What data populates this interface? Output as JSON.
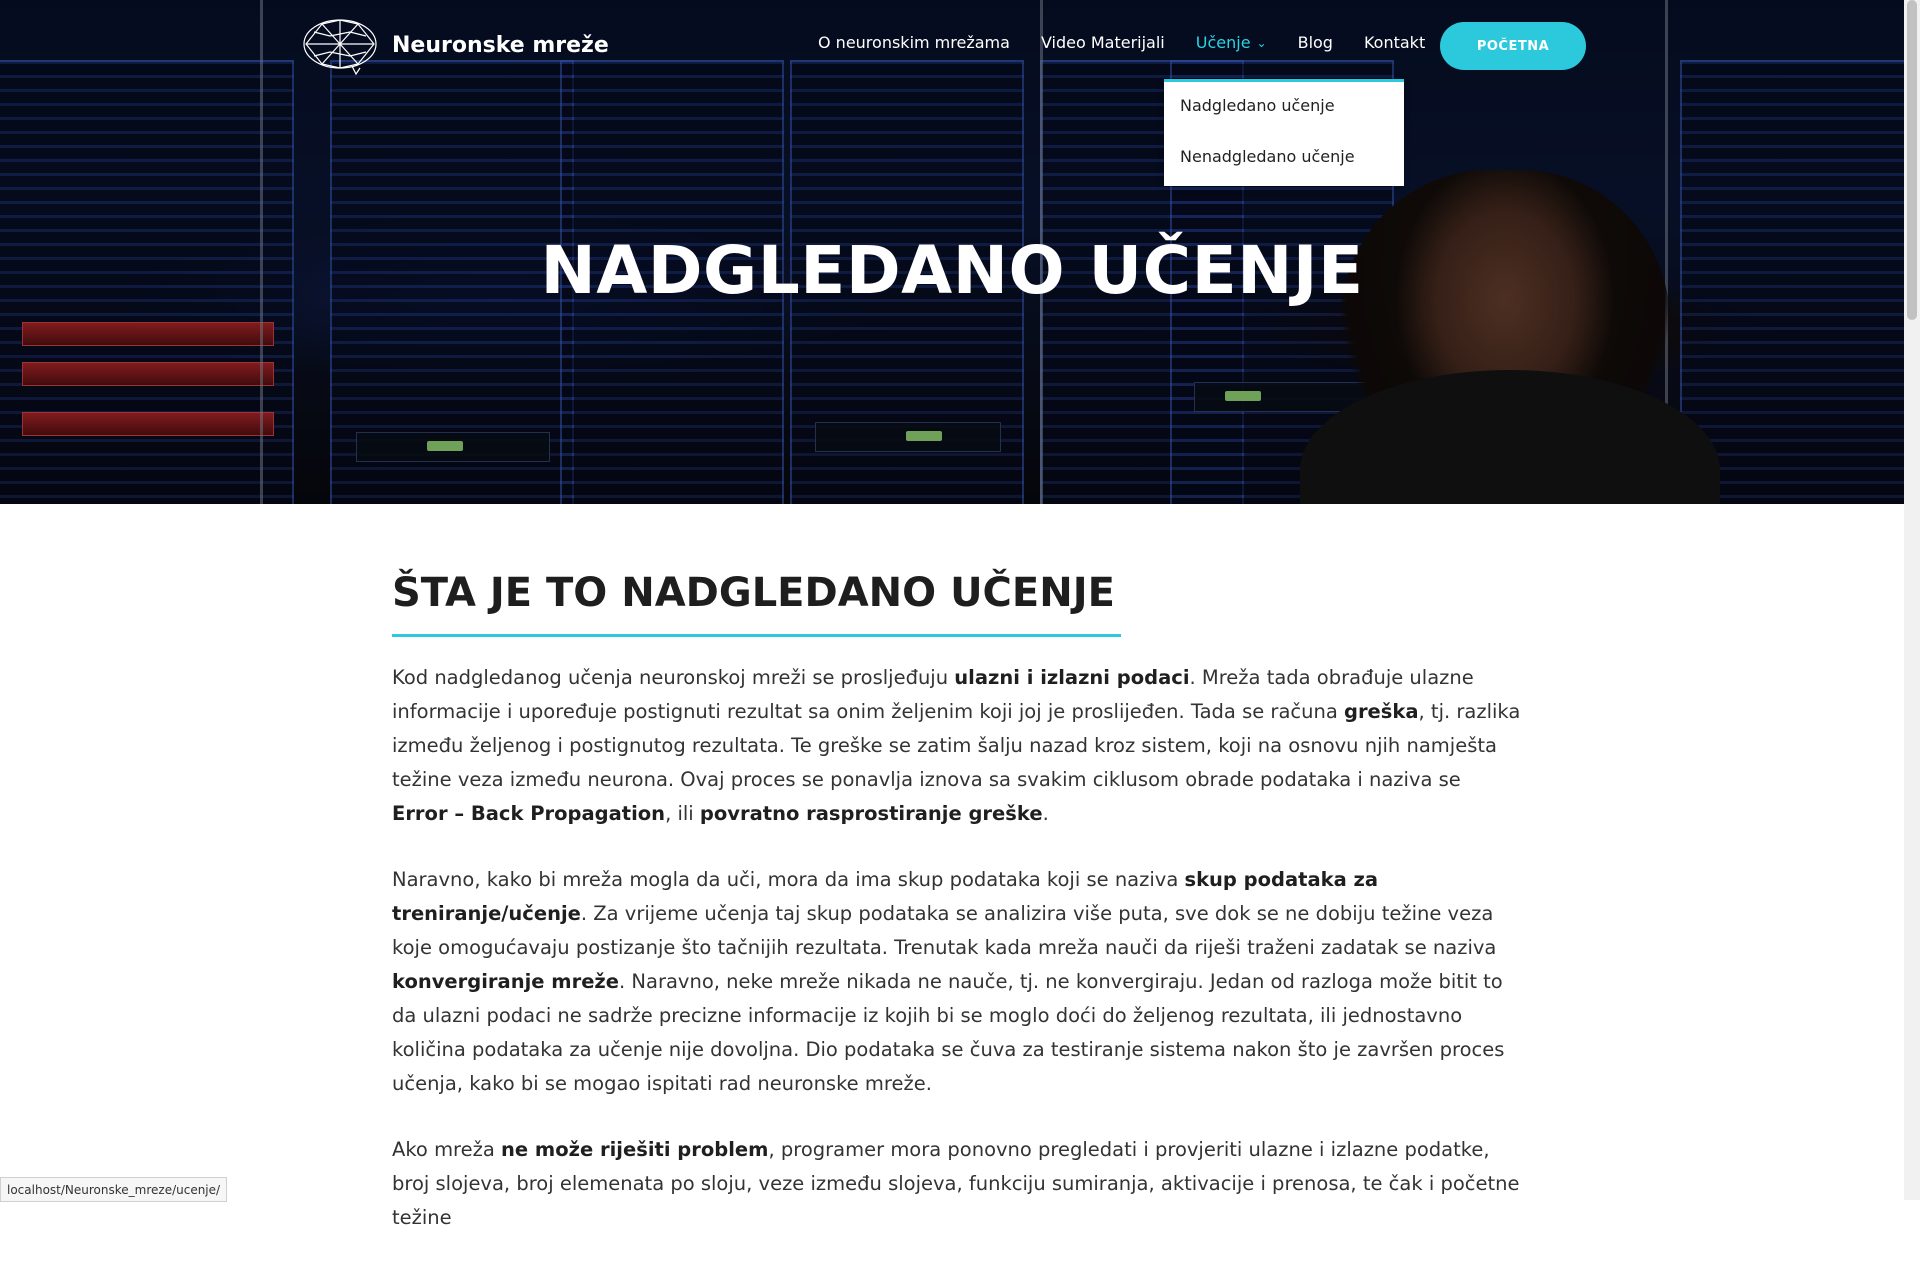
{
  "brand": {
    "name": "Neuronske mreže",
    "accent": "#2cc9dc"
  },
  "nav": {
    "items": [
      "O neuronskim mrežama",
      "Video Materijali",
      "Učenje",
      "Blog",
      "Kontakt"
    ],
    "active": "Učenje",
    "cta": "POČETNA"
  },
  "dropdown": {
    "items": [
      "Nadgledano učenje",
      "Nenadgledano učenje"
    ]
  },
  "hero": {
    "title": "NADGLEDANO UČENJE"
  },
  "section": {
    "title": "ŠTA JE TO NADGLEDANO UČENJE",
    "p1": [
      "Kod nadgledanog učenja neuronskoj mreži se prosljeđuju ",
      "ulazni i izlazni podaci",
      ". Mreža tada obrađuje ulazne informacije i upoređuje postignuti rezultat sa onim željenim koji joj je proslijeđen. Tada se računa ",
      "greška",
      ", tj. razlika između željenog i postignutog rezultata. Te greške se zatim šalju nazad kroz sistem, koji na osnovu njih namješta težine veza između neurona. Ovaj proces se ponavlja iznova sa svakim ciklusom obrade podataka i naziva se ",
      "Error – Back Propagation",
      ", ili ",
      "povratno rasprostiranje greške",
      "."
    ],
    "p2": [
      "Naravno, kako bi mreža mogla da uči, mora da ima skup podataka koji se naziva ",
      "skup podataka za treniranje/učenje",
      ". Za vrijeme učenja taj skup podataka se analizira više puta, sve dok se ne dobiju težine veza koje omogućavaju postizanje što tačnijih rezultata. Trenutak kada mreža nauči da riješi traženi zadatak se naziva ",
      "konvergiranje mreže",
      ". Naravno, neke mreže nikada ne nauče, tj. ne konvergiraju. Jedan od razloga može bitit to da ulazni podaci ne sadrže precizne informacije iz kojih bi se moglo doći do željenog rezultata, ili jednostavno količina podataka za učenje nije dovoljna. Dio podataka se čuva za testiranje sistema nakon što je završen proces učenja, kako bi se mogao ispitati rad neuronske mreže."
    ],
    "p3": [
      "Ako mreža ",
      "ne može riješiti problem",
      ", programer mora ponovno pregledati i provjeriti ulazne i izlazne podatke, broj slojeva, broj elemenata po sloju, veze između slojeva, funkciju sumiranja, aktivacije i prenosa, te čak i početne težine"
    ]
  },
  "status_url": "localhost/Neuronske_mreze/ucenje/"
}
